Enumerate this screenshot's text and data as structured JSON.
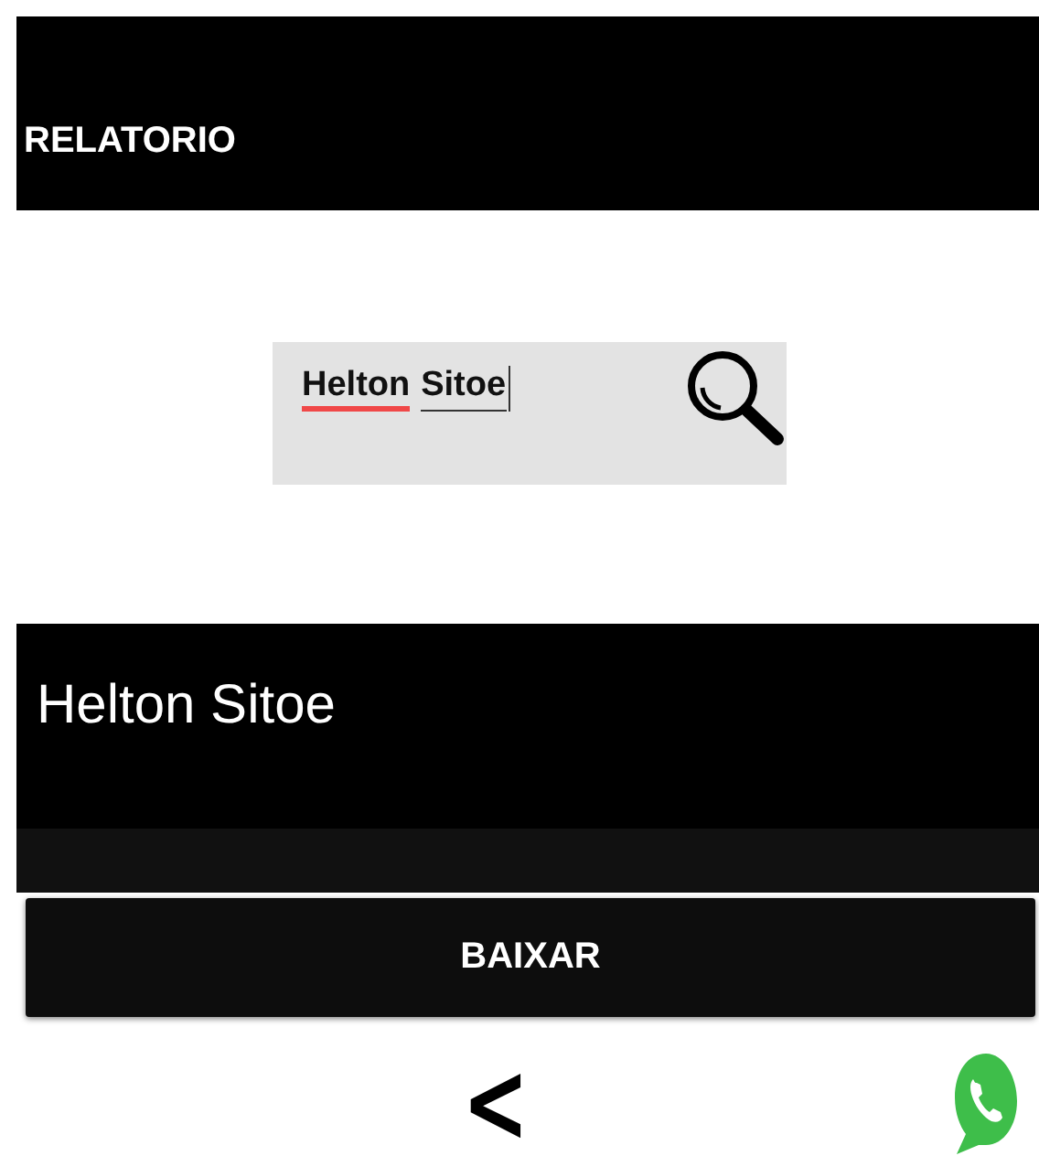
{
  "header": {
    "title": "RELATORIO"
  },
  "search": {
    "value": "Helton Sitoe"
  },
  "result": {
    "name": "Helton Sitoe"
  },
  "buttons": [
    "BAIXAR"
  ],
  "nav": {
    "back": "<"
  }
}
